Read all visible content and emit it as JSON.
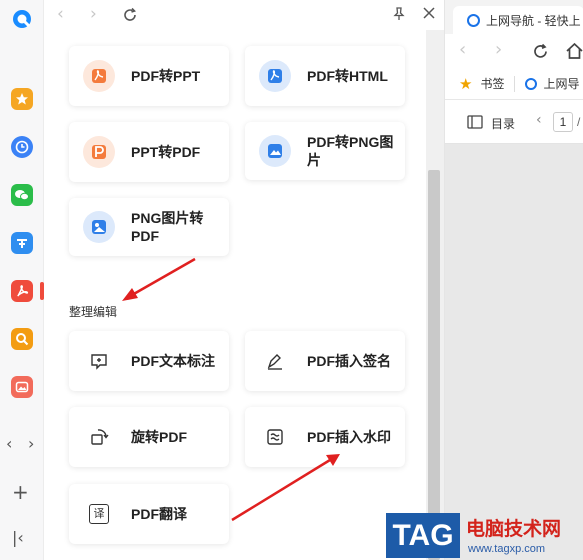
{
  "rail": {
    "apps": [
      {
        "name": "favorites",
        "color": "#f5a623"
      },
      {
        "name": "clock",
        "color": "#3b82f6"
      },
      {
        "name": "wechat",
        "color": "#2bbd4a"
      },
      {
        "name": "translate",
        "color": "#2f8ef0"
      },
      {
        "name": "pdf",
        "color": "#ef4b3c"
      },
      {
        "name": "search",
        "color": "#f39c12"
      },
      {
        "name": "image",
        "color": "#f26b5b"
      }
    ]
  },
  "panel": {
    "convert_cards": [
      {
        "label": "PDF转PPT",
        "icon": "pdf-to-ppt-icon",
        "tone": "orange"
      },
      {
        "label": "PDF转HTML",
        "icon": "pdf-to-html-icon",
        "tone": "blue"
      },
      {
        "label": "PPT转PDF",
        "icon": "ppt-to-pdf-icon",
        "tone": "orange"
      },
      {
        "label": "PDF转PNG图片",
        "icon": "pdf-to-png-icon",
        "tone": "blue"
      },
      {
        "label": "PNG图片转PDF",
        "icon": "png-to-pdf-icon",
        "tone": "blue"
      }
    ],
    "section_title": "整理编辑",
    "edit_cards": [
      {
        "label": "PDF文本标注",
        "icon": "text-annotation-icon"
      },
      {
        "label": "PDF插入签名",
        "icon": "signature-icon"
      },
      {
        "label": "旋转PDF",
        "icon": "rotate-icon"
      },
      {
        "label": "PDF插入水印",
        "icon": "watermark-icon"
      },
      {
        "label": "PDF翻译",
        "icon": "translate-icon"
      }
    ],
    "translate_glyph": "译"
  },
  "browser": {
    "tab_title": "上网导航 - 轻快上",
    "bookmark_label": "书签",
    "bookmark_item": "上网导",
    "toc_label": "目录",
    "page_input": "1",
    "page_sep": "/"
  },
  "watermark": {
    "brand": "TAG",
    "site_name": "电脑技术网",
    "url": "www.tagxp.com"
  }
}
